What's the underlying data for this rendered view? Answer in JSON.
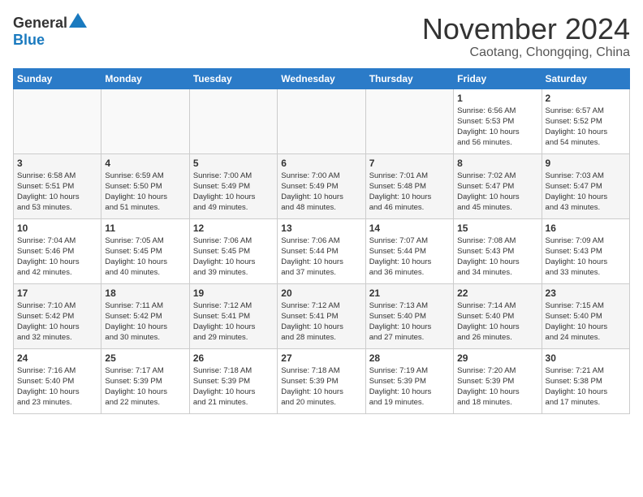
{
  "header": {
    "logo": {
      "general": "General",
      "blue": "Blue"
    },
    "title": "November 2024",
    "location": "Caotang, Chongqing, China"
  },
  "weekdays": [
    "Sunday",
    "Monday",
    "Tuesday",
    "Wednesday",
    "Thursday",
    "Friday",
    "Saturday"
  ],
  "weeks": [
    [
      {
        "day": "",
        "info": ""
      },
      {
        "day": "",
        "info": ""
      },
      {
        "day": "",
        "info": ""
      },
      {
        "day": "",
        "info": ""
      },
      {
        "day": "",
        "info": ""
      },
      {
        "day": "1",
        "info": "Sunrise: 6:56 AM\nSunset: 5:53 PM\nDaylight: 10 hours\nand 56 minutes."
      },
      {
        "day": "2",
        "info": "Sunrise: 6:57 AM\nSunset: 5:52 PM\nDaylight: 10 hours\nand 54 minutes."
      }
    ],
    [
      {
        "day": "3",
        "info": "Sunrise: 6:58 AM\nSunset: 5:51 PM\nDaylight: 10 hours\nand 53 minutes."
      },
      {
        "day": "4",
        "info": "Sunrise: 6:59 AM\nSunset: 5:50 PM\nDaylight: 10 hours\nand 51 minutes."
      },
      {
        "day": "5",
        "info": "Sunrise: 7:00 AM\nSunset: 5:49 PM\nDaylight: 10 hours\nand 49 minutes."
      },
      {
        "day": "6",
        "info": "Sunrise: 7:00 AM\nSunset: 5:49 PM\nDaylight: 10 hours\nand 48 minutes."
      },
      {
        "day": "7",
        "info": "Sunrise: 7:01 AM\nSunset: 5:48 PM\nDaylight: 10 hours\nand 46 minutes."
      },
      {
        "day": "8",
        "info": "Sunrise: 7:02 AM\nSunset: 5:47 PM\nDaylight: 10 hours\nand 45 minutes."
      },
      {
        "day": "9",
        "info": "Sunrise: 7:03 AM\nSunset: 5:47 PM\nDaylight: 10 hours\nand 43 minutes."
      }
    ],
    [
      {
        "day": "10",
        "info": "Sunrise: 7:04 AM\nSunset: 5:46 PM\nDaylight: 10 hours\nand 42 minutes."
      },
      {
        "day": "11",
        "info": "Sunrise: 7:05 AM\nSunset: 5:45 PM\nDaylight: 10 hours\nand 40 minutes."
      },
      {
        "day": "12",
        "info": "Sunrise: 7:06 AM\nSunset: 5:45 PM\nDaylight: 10 hours\nand 39 minutes."
      },
      {
        "day": "13",
        "info": "Sunrise: 7:06 AM\nSunset: 5:44 PM\nDaylight: 10 hours\nand 37 minutes."
      },
      {
        "day": "14",
        "info": "Sunrise: 7:07 AM\nSunset: 5:44 PM\nDaylight: 10 hours\nand 36 minutes."
      },
      {
        "day": "15",
        "info": "Sunrise: 7:08 AM\nSunset: 5:43 PM\nDaylight: 10 hours\nand 34 minutes."
      },
      {
        "day": "16",
        "info": "Sunrise: 7:09 AM\nSunset: 5:43 PM\nDaylight: 10 hours\nand 33 minutes."
      }
    ],
    [
      {
        "day": "17",
        "info": "Sunrise: 7:10 AM\nSunset: 5:42 PM\nDaylight: 10 hours\nand 32 minutes."
      },
      {
        "day": "18",
        "info": "Sunrise: 7:11 AM\nSunset: 5:42 PM\nDaylight: 10 hours\nand 30 minutes."
      },
      {
        "day": "19",
        "info": "Sunrise: 7:12 AM\nSunset: 5:41 PM\nDaylight: 10 hours\nand 29 minutes."
      },
      {
        "day": "20",
        "info": "Sunrise: 7:12 AM\nSunset: 5:41 PM\nDaylight: 10 hours\nand 28 minutes."
      },
      {
        "day": "21",
        "info": "Sunrise: 7:13 AM\nSunset: 5:40 PM\nDaylight: 10 hours\nand 27 minutes."
      },
      {
        "day": "22",
        "info": "Sunrise: 7:14 AM\nSunset: 5:40 PM\nDaylight: 10 hours\nand 26 minutes."
      },
      {
        "day": "23",
        "info": "Sunrise: 7:15 AM\nSunset: 5:40 PM\nDaylight: 10 hours\nand 24 minutes."
      }
    ],
    [
      {
        "day": "24",
        "info": "Sunrise: 7:16 AM\nSunset: 5:40 PM\nDaylight: 10 hours\nand 23 minutes."
      },
      {
        "day": "25",
        "info": "Sunrise: 7:17 AM\nSunset: 5:39 PM\nDaylight: 10 hours\nand 22 minutes."
      },
      {
        "day": "26",
        "info": "Sunrise: 7:18 AM\nSunset: 5:39 PM\nDaylight: 10 hours\nand 21 minutes."
      },
      {
        "day": "27",
        "info": "Sunrise: 7:18 AM\nSunset: 5:39 PM\nDaylight: 10 hours\nand 20 minutes."
      },
      {
        "day": "28",
        "info": "Sunrise: 7:19 AM\nSunset: 5:39 PM\nDaylight: 10 hours\nand 19 minutes."
      },
      {
        "day": "29",
        "info": "Sunrise: 7:20 AM\nSunset: 5:39 PM\nDaylight: 10 hours\nand 18 minutes."
      },
      {
        "day": "30",
        "info": "Sunrise: 7:21 AM\nSunset: 5:38 PM\nDaylight: 10 hours\nand 17 minutes."
      }
    ]
  ]
}
